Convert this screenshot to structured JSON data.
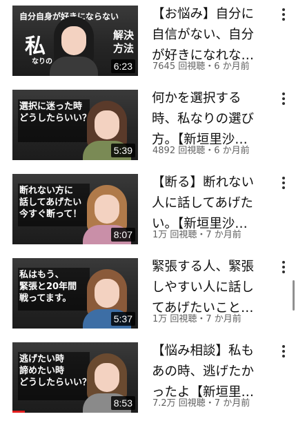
{
  "videos": [
    {
      "thumb_text": "自分自身が好きにならない",
      "thumb_big": "私",
      "thumb_small": "なりの",
      "thumb_side": "解決\n方法",
      "duration": "6:23",
      "title": "【お悩み】自分に\n自信がない、自分\nが好きになれな…",
      "meta": "7645 回視聴・6 か月前"
    },
    {
      "thumb_text": "選択に迷った時\nどうしたらいい？",
      "duration": "5:39",
      "title": "何かを選択する\n時、私なりの選び\n方。【新垣里沙…",
      "meta": "4892 回視聴・6 か月前"
    },
    {
      "thumb_text": "断れない方に\n話してあげたい\n今すぐ断って！",
      "duration": "8:07",
      "title": "【断る】断れない\n人に話してあげた\nい。【新垣里沙…",
      "meta": "1万 回視聴・7 か月前"
    },
    {
      "thumb_text": "私はもう、\n緊張と20年間\n戦ってます。",
      "duration": "5:37",
      "title": "緊張する人、緊張\nしやすい人に話し\nてあげたいこと…",
      "meta": "1万 回視聴・7 か月前"
    },
    {
      "thumb_text": "逃げたい時\n諦めたい時\nどうしたらいい？",
      "duration": "8:53",
      "title": "【悩み相談】私も\nあの時、逃げたか\nったよ【新垣里…",
      "meta": "7.2万 回視聴・7 か月前",
      "watch_progress": 0.1
    }
  ],
  "icons": {
    "more": "more-vert-icon"
  },
  "colors": {
    "title": "#0f0f0f",
    "meta": "#606060",
    "progress": "#e31d1d"
  }
}
